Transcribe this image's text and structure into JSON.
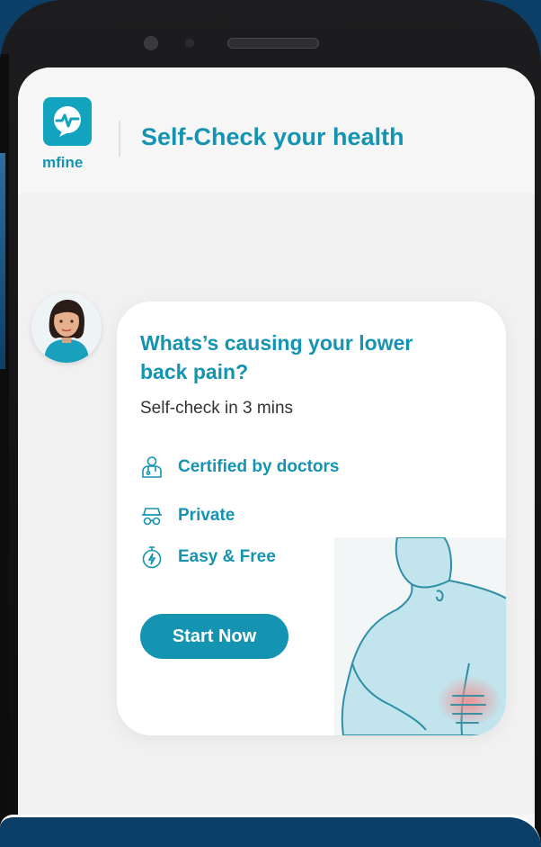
{
  "app": {
    "logo_text": "mfine",
    "title": "Self-Check your health"
  },
  "card": {
    "title": "Whats’s causing your lower back pain?",
    "subtitle": "Self-check in 3 mins",
    "features": [
      {
        "label": "Certified by doctors",
        "icon": "doctor-icon"
      },
      {
        "label": "Private",
        "icon": "incognito-icon"
      },
      {
        "label": "Easy & Free",
        "icon": "stopwatch-icon"
      }
    ],
    "cta_label": "Start Now"
  },
  "colors": {
    "brand": "#1594b2",
    "logo_bg": "#12a3be",
    "page_bg": "#0b3f67"
  }
}
